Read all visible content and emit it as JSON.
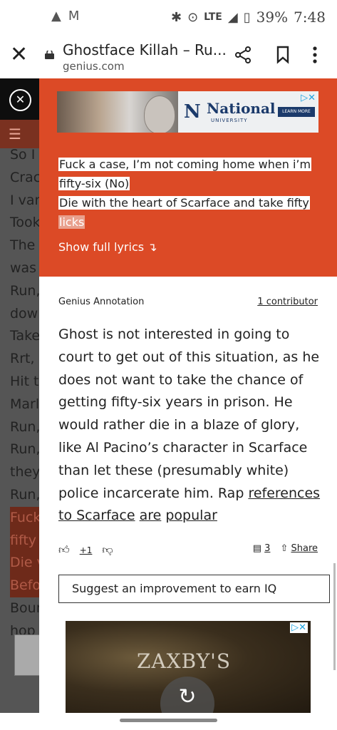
{
  "status_bar": {
    "lte": "LTE",
    "battery": "39%",
    "time": "7:48"
  },
  "browser": {
    "title": "Ghostface Killah – Ru...",
    "domain": "genius.com"
  },
  "background_lyrics": [
    "So I",
    "Crac",
    "I van",
    "Took",
    "The",
    "was",
    "Run,",
    "dow",
    "Take",
    "Rrt,",
    "Hit t",
    "Marl",
    "Run,",
    "Run,",
    "they",
    "Run,",
    "Fuck",
    "fifty",
    "Die v",
    "Befo",
    "Boun",
    "hop"
  ],
  "ad_top": {
    "brand": "National",
    "subtitle": "UNIVERSITY",
    "cta": "LEARN MORE",
    "adchoices": "▷✕"
  },
  "quote": {
    "line1": "Fuck a case, I’m not coming home when i’m",
    "line2": "fifty-six (No)",
    "line3": "Die with the heart of Scarface and take fifty",
    "line4": "licks"
  },
  "show_full_lyrics": "Show full lyrics ↴",
  "annotation": {
    "label": "Genius Annotation",
    "contributors": "1 contributor",
    "body": "Ghost is not interested in going to court to get out of this situation, as he does not want to take the chance of getting fifty-six years in prison. He would rather die in a blaze of glory, like Al Pacino’s character in Scarface than let these (presumably white) police incarcerate him. Rap ",
    "link1": "references",
    "link2": "to Scarface",
    "link3": "are",
    "link4": "popular"
  },
  "votes": {
    "count": "+1",
    "comments": "3",
    "share": "Share"
  },
  "suggest": "Suggest an improvement to earn IQ",
  "ad_bottom": {
    "brand": "ZAXBY'S",
    "adchoices": "▷✕"
  }
}
